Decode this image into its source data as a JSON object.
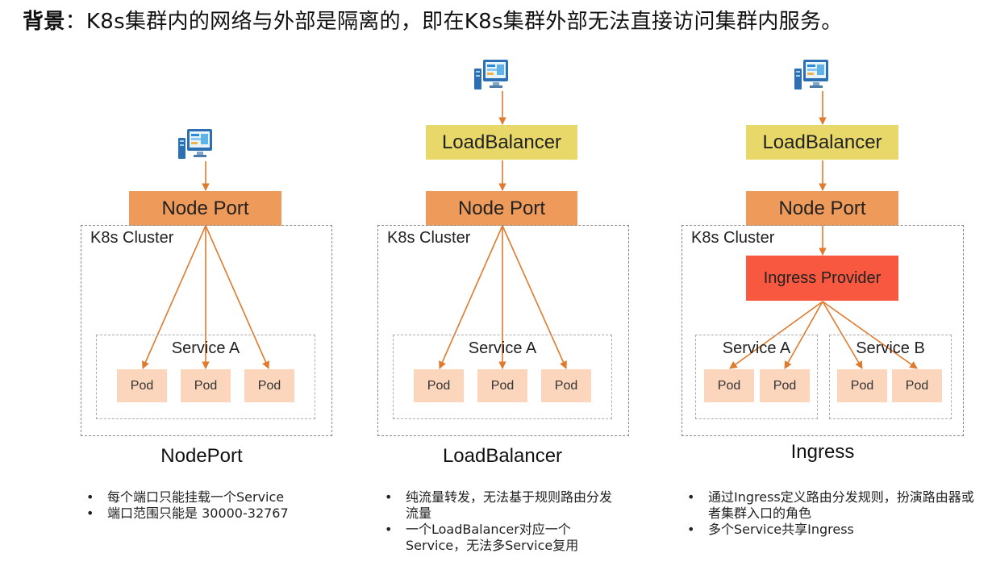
{
  "title": {
    "bold": "背景",
    "rest": "：K8s集群内的网络与外部是隔离的，即在K8s集群外部无法直接访问集群内服务。"
  },
  "colors": {
    "arrow": "#e07a2c",
    "load_balancer": "#e8d86a",
    "node_port": "#ee9a5a",
    "ingress_provider": "#f8583f",
    "pod": "#fbd6bd"
  },
  "panels": [
    {
      "caption": "NodePort",
      "cluster_label": "K8s Cluster",
      "node_port": "Node Port",
      "service": "Service A",
      "pods": [
        "Pod",
        "Pod",
        "Pod"
      ],
      "notes": [
        "每个端口只能挂载一个Service",
        "端口范围只能是 30000-32767"
      ]
    },
    {
      "caption": "LoadBalancer",
      "cluster_label": "K8s Cluster",
      "load_balancer": "LoadBalancer",
      "node_port": "Node Port",
      "service": "Service A",
      "pods": [
        "Pod",
        "Pod",
        "Pod"
      ],
      "notes": [
        "纯流量转发，无法基于规则路由分发流量",
        "一个LoadBalancer对应一个Service，无法多Service复用"
      ]
    },
    {
      "caption": "Ingress",
      "cluster_label": "K8s Cluster",
      "load_balancer": "LoadBalancer",
      "node_port": "Node Port",
      "ingress_provider": "Ingress Provider",
      "services": [
        {
          "name": "Service A",
          "pods": [
            "Pod",
            "Pod"
          ]
        },
        {
          "name": "Service B",
          "pods": [
            "Pod",
            "Pod"
          ]
        }
      ],
      "notes": [
        "通过Ingress定义路由分发规则，扮演路由器或者集群入口的角色",
        "多个Service共享Ingress"
      ]
    }
  ]
}
